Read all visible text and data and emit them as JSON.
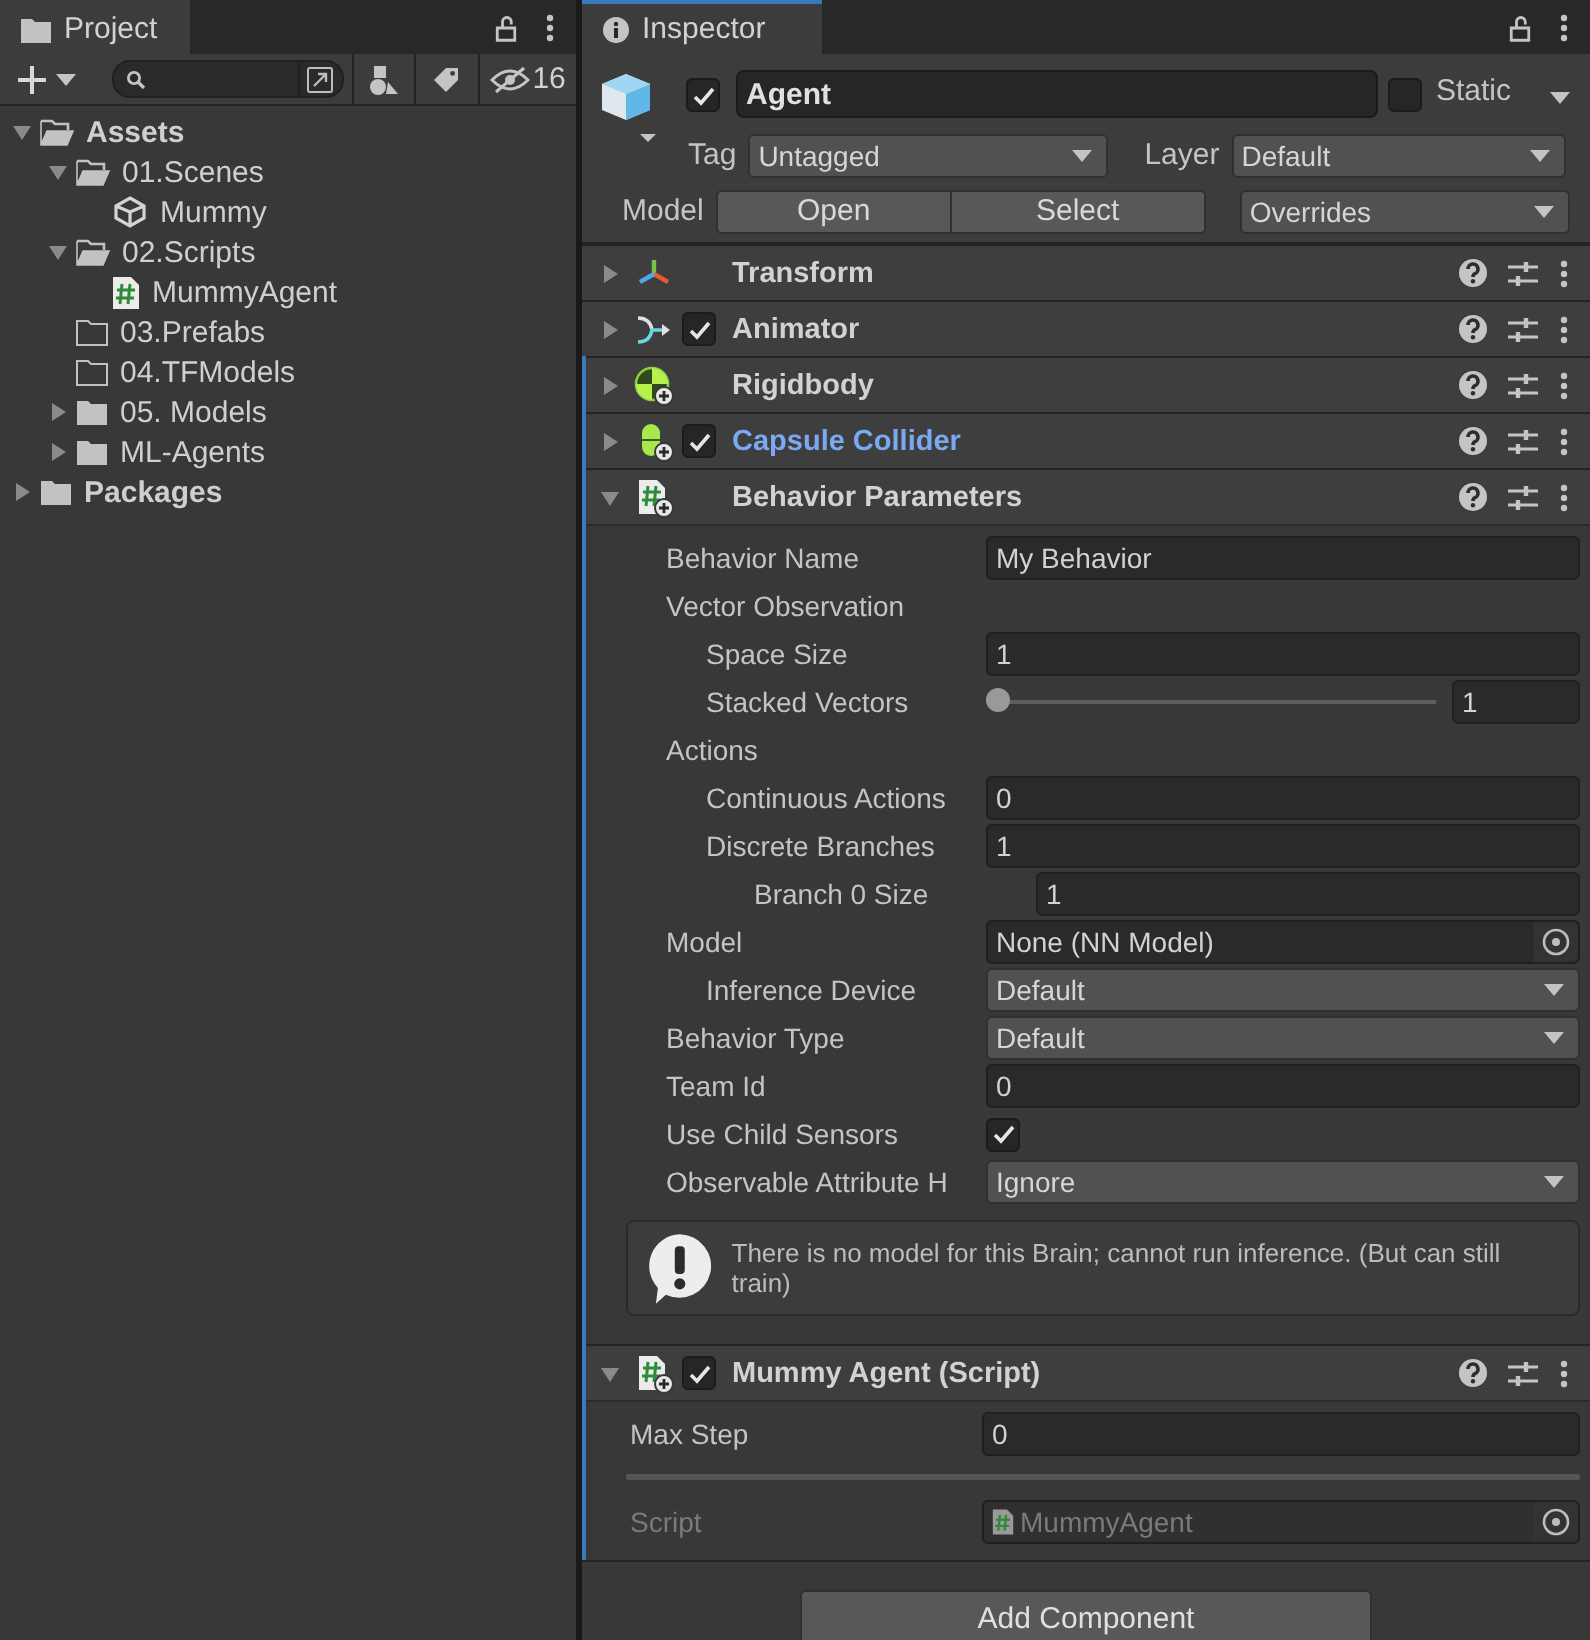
{
  "project": {
    "title": "Project",
    "hidden_count": "16",
    "tree": [
      {
        "label": "Assets",
        "kind": "folder",
        "expanded": true,
        "children": [
          {
            "label": "01.Scenes",
            "kind": "folder",
            "expanded": true,
            "children": [
              {
                "label": "Mummy",
                "kind": "scene"
              }
            ]
          },
          {
            "label": "02.Scripts",
            "kind": "folder",
            "expanded": true,
            "children": [
              {
                "label": "MummyAgent",
                "kind": "script"
              }
            ]
          },
          {
            "label": "03.Prefabs",
            "kind": "empty-folder"
          },
          {
            "label": "04.TFModels",
            "kind": "empty-folder"
          },
          {
            "label": "05. Models",
            "kind": "folder",
            "expanded": false
          },
          {
            "label": "ML-Agents",
            "kind": "folder",
            "expanded": false
          }
        ]
      },
      {
        "label": "Packages",
        "kind": "folder",
        "expanded": false
      }
    ]
  },
  "inspector": {
    "title": "Inspector",
    "object": {
      "active": true,
      "name": "Agent",
      "static": false,
      "static_label": "Static",
      "tag_label": "Tag",
      "tag": "Untagged",
      "layer_label": "Layer",
      "layer": "Default",
      "model_label": "Model",
      "open_button": "Open",
      "select_button": "Select",
      "overrides": "Overrides"
    },
    "components": [
      {
        "name": "Transform",
        "kind": "transform",
        "expanded": false,
        "added": false,
        "modified": false
      },
      {
        "name": "Animator",
        "kind": "animator",
        "expanded": false,
        "added": false,
        "modified": false,
        "enabled": true
      },
      {
        "name": "Rigidbody",
        "kind": "rigidbody",
        "expanded": false,
        "added": true,
        "modified": false
      },
      {
        "name": "Capsule Collider",
        "kind": "collider",
        "expanded": false,
        "added": true,
        "modified": true,
        "enabled": true
      },
      {
        "name": "Behavior Parameters",
        "kind": "behavior",
        "expanded": true,
        "added": true,
        "modified": false,
        "fields": [
          {
            "label": "Behavior Name",
            "kind": "text",
            "value": "My Behavior"
          },
          {
            "label": "Vector Observation",
            "kind": "header",
            "children": [
              {
                "label": "Space Size",
                "kind": "text",
                "value": "1"
              },
              {
                "label": "Stacked Vectors",
                "kind": "slider",
                "level": 0,
                "value": "1"
              }
            ]
          },
          {
            "label": "Actions",
            "kind": "header",
            "children": [
              {
                "label": "Continuous Actions",
                "kind": "text",
                "value": "0"
              },
              {
                "label": "Discrete Branches",
                "kind": "text",
                "value": "1",
                "children": [
                  {
                    "label": "Branch 0 Size",
                    "kind": "text",
                    "value": "1"
                  }
                ]
              }
            ]
          },
          {
            "label": "Model",
            "kind": "object",
            "value": "None (NN Model)",
            "children": [
              {
                "label": "Inference Device",
                "kind": "dropdown",
                "value": "Default"
              }
            ]
          },
          {
            "label": "Behavior Type",
            "kind": "dropdown",
            "value": "Default"
          },
          {
            "label": "Team Id",
            "kind": "text",
            "value": "0"
          },
          {
            "label": "Use Child Sensors",
            "kind": "checkbox",
            "checked": true
          },
          {
            "label": "Observable Attribute H",
            "kind": "dropdown",
            "value": "Ignore"
          },
          {
            "kind": "help",
            "text": "There is no model for this Brain; cannot run inference. (But can still train)"
          }
        ]
      },
      {
        "name": "Mummy Agent (Script)",
        "kind": "script",
        "expanded": true,
        "added": true,
        "modified": false,
        "enabled": true,
        "fields": [
          {
            "label": "Max Step",
            "kind": "text",
            "value": "0"
          },
          {
            "kind": "separator"
          },
          {
            "label": "Script",
            "kind": "script",
            "value": "MummyAgent",
            "disabled": true
          }
        ]
      }
    ],
    "add_button": "Add Component"
  }
}
